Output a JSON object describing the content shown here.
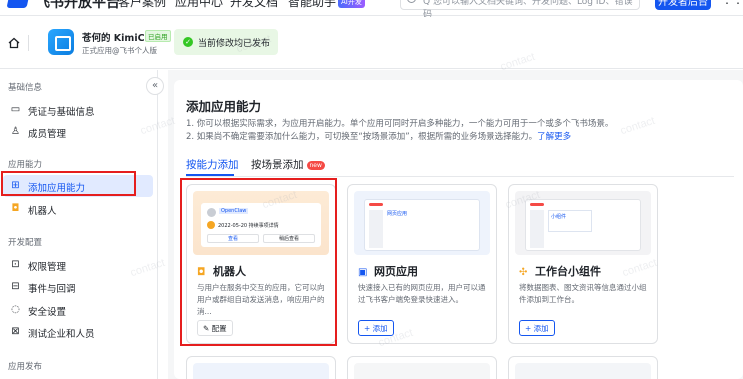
{
  "topnav": {
    "brand": "飞书开放平台",
    "items": [
      "客户案例",
      "应用中心",
      "开发文档",
      "智能助手"
    ],
    "ai_tag": "AI开发",
    "search_placeholder": "Q 您可以输入文档关键词、开发问题、Log ID、错误码",
    "console_button": "开发者后台"
  },
  "appbar": {
    "app_name": "苍何的 KimiClaw",
    "app_tag": "已启用",
    "app_sub": "正式应用@飞书个人版",
    "publish_status": "当前修改均已发布"
  },
  "sidebar": {
    "sections": [
      {
        "title": "基础信息",
        "items": [
          {
            "label": "凭证与基础信息",
            "icon": "credential-icon"
          },
          {
            "label": "成员管理",
            "icon": "user-icon"
          }
        ]
      },
      {
        "title": "应用能力",
        "items": [
          {
            "label": "添加应用能力",
            "icon": "grid-add-icon",
            "active": true
          },
          {
            "label": "机器人",
            "icon": "robot-icon"
          }
        ]
      },
      {
        "title": "开发配置",
        "items": [
          {
            "label": "权限管理",
            "icon": "lock-icon"
          },
          {
            "label": "事件与回调",
            "icon": "event-icon"
          },
          {
            "label": "安全设置",
            "icon": "shield-icon"
          },
          {
            "label": "测试企业和人员",
            "icon": "test-icon"
          }
        ]
      },
      {
        "title": "应用发布",
        "items": []
      }
    ]
  },
  "main": {
    "title": "添加应用能力",
    "desc1": "1. 你可以根据实际需求，为应用开启能力。单个应用可同时开启多种能力，一个能力可用于一个或多个飞书场景。",
    "desc2": "2. 如果尚不确定需要添加什么能力，可切换至“按场景添加”，根据所需的业务场景选择能力。",
    "desc2_link": "了解更多",
    "tabs": [
      {
        "label": "按能力添加",
        "active": true
      },
      {
        "label": "按场景添加",
        "badge": "new"
      }
    ],
    "cards": [
      {
        "title": "机器人",
        "icon": "robot-icon",
        "desc": "与用户在服务中交互的应用，它可以向用户或群组自动发送消息，响应用户的消...",
        "button": "✎ 配置"
      },
      {
        "title": "网页应用",
        "icon": "web-app-icon",
        "desc": "快速接入已有的网页应用，用户可以通过飞书客户端免登录快速进入。",
        "button": "+ 添加"
      },
      {
        "title": "工作台小组件",
        "icon": "widget-icon",
        "desc": "将数据图表、图文资讯等信息通过小组件添加到工作台。",
        "button": "+ 添加"
      }
    ],
    "preview_robot": {
      "bot_name": "OpenClaw",
      "msg": "2022-05-20 持续事项详情",
      "btn1": "查看",
      "btn2": "稍后查看"
    },
    "preview_web": {
      "label": "网页应用"
    },
    "preview_widget": {
      "label": "小组件"
    }
  },
  "colors": {
    "accent": "#1456f0",
    "highlight": "#e51e1e",
    "success": "#34c724"
  }
}
